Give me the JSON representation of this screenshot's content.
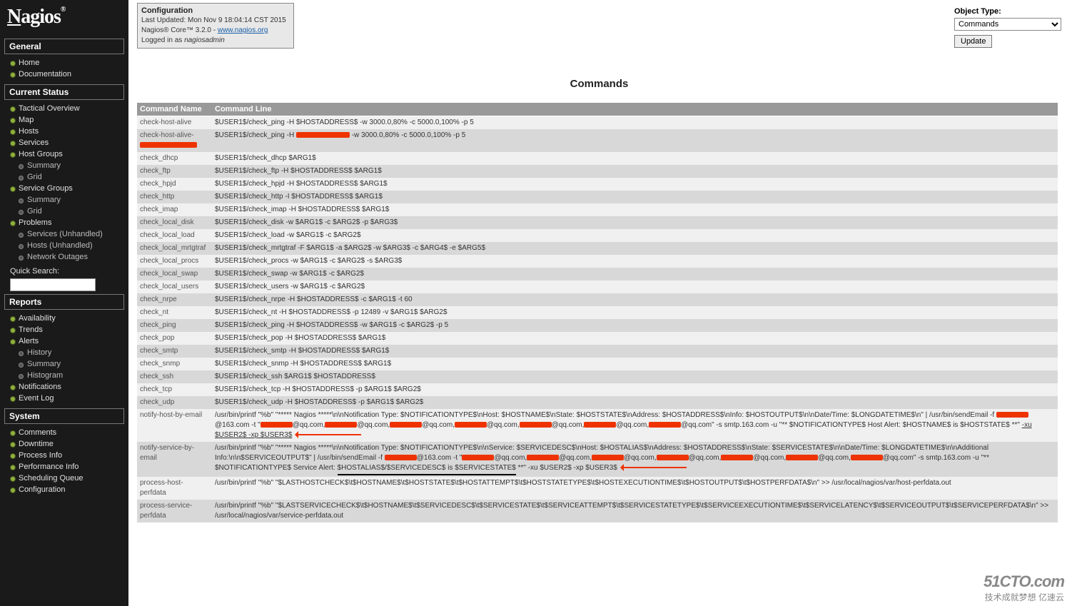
{
  "logo": "Nagios",
  "info_box": {
    "title": "Configuration",
    "last_updated": "Last Updated: Mon Nov 9 18:04:14 CST 2015",
    "version": "Nagios® Core™ 3.2.0 - ",
    "version_link": "www.nagios.org",
    "logged_in": "Logged in as ",
    "user": "nagiosadmin"
  },
  "top_right": {
    "label": "Object Type:",
    "selected": "Commands",
    "button": "Update"
  },
  "page_title": "Commands",
  "sidebar": {
    "general": {
      "header": "General",
      "items": [
        "Home",
        "Documentation"
      ]
    },
    "current_status": {
      "header": "Current Status",
      "items": [
        {
          "label": "Tactical Overview"
        },
        {
          "label": "Map"
        },
        {
          "label": "Hosts"
        },
        {
          "label": "Services"
        },
        {
          "label": "Host Groups",
          "subs": [
            "Summary",
            "Grid"
          ]
        },
        {
          "label": "Service Groups",
          "subs": [
            "Summary",
            "Grid"
          ]
        },
        {
          "label": "Problems",
          "subs": [
            "Services (Unhandled)",
            "Hosts (Unhandled)",
            "Network Outages"
          ]
        }
      ],
      "quick_search": "Quick Search:"
    },
    "reports": {
      "header": "Reports",
      "items": [
        {
          "label": "Availability"
        },
        {
          "label": "Trends"
        },
        {
          "label": "Alerts",
          "subs": [
            "History",
            "Summary",
            "Histogram"
          ]
        },
        {
          "label": "Notifications"
        },
        {
          "label": "Event Log"
        }
      ]
    },
    "system": {
      "header": "System",
      "items": [
        "Comments",
        "Downtime",
        "Process Info",
        "Performance Info",
        "Scheduling Queue",
        "Configuration"
      ]
    }
  },
  "table": {
    "headers": [
      "Command Name",
      "Command Line"
    ],
    "rows": [
      {
        "name": "check-host-alive",
        "line": "$USER1$/check_ping -H $HOSTADDRESS$ -w 3000.0,80% -c 5000.0,100% -p 5"
      },
      {
        "name": "check-host-alive-",
        "redact_name": true,
        "line_prefix": "$USER1$/check_ping -H ",
        "line_suffix": " -w 3000.0,80% -c 5000.0,100% -p 5",
        "redact_mid": true
      },
      {
        "name": "check_dhcp",
        "line": "$USER1$/check_dhcp $ARG1$"
      },
      {
        "name": "check_ftp",
        "line": "$USER1$/check_ftp -H $HOSTADDRESS$ $ARG1$"
      },
      {
        "name": "check_hpjd",
        "line": "$USER1$/check_hpjd -H $HOSTADDRESS$ $ARG1$"
      },
      {
        "name": "check_http",
        "line": "$USER1$/check_http -I $HOSTADDRESS$ $ARG1$"
      },
      {
        "name": "check_imap",
        "line": "$USER1$/check_imap -H $HOSTADDRESS$ $ARG1$"
      },
      {
        "name": "check_local_disk",
        "line": "$USER1$/check_disk -w $ARG1$ -c $ARG2$ -p $ARG3$"
      },
      {
        "name": "check_local_load",
        "line": "$USER1$/check_load -w $ARG1$ -c $ARG2$"
      },
      {
        "name": "check_local_mrtgtraf",
        "line": "$USER1$/check_mrtgtraf -F $ARG1$ -a $ARG2$ -w $ARG3$ -c $ARG4$ -e $ARG5$"
      },
      {
        "name": "check_local_procs",
        "line": "$USER1$/check_procs -w $ARG1$ -c $ARG2$ -s $ARG3$"
      },
      {
        "name": "check_local_swap",
        "line": "$USER1$/check_swap -w $ARG1$ -c $ARG2$"
      },
      {
        "name": "check_local_users",
        "line": "$USER1$/check_users -w $ARG1$ -c $ARG2$"
      },
      {
        "name": "check_nrpe",
        "line": "$USER1$/check_nrpe -H $HOSTADDRESS$ -c $ARG1$ -t 60"
      },
      {
        "name": "check_nt",
        "line": "$USER1$/check_nt -H $HOSTADDRESS$ -p 12489 -v $ARG1$ $ARG2$"
      },
      {
        "name": "check_ping",
        "line": "$USER1$/check_ping -H $HOSTADDRESS$ -w $ARG1$ -c $ARG2$ -p 5"
      },
      {
        "name": "check_pop",
        "line": "$USER1$/check_pop -H $HOSTADDRESS$ $ARG1$"
      },
      {
        "name": "check_smtp",
        "line": "$USER1$/check_smtp -H $HOSTADDRESS$ $ARG1$"
      },
      {
        "name": "check_snmp",
        "line": "$USER1$/check_snmp -H $HOSTADDRESS$ $ARG1$"
      },
      {
        "name": "check_ssh",
        "line": "$USER1$/check_ssh $ARG1$ $HOSTADDRESS$"
      },
      {
        "name": "check_tcp",
        "line": "$USER1$/check_tcp -H $HOSTADDRESS$ -p $ARG1$ $ARG2$"
      },
      {
        "name": "check_udp",
        "line": "$USER1$/check_udp -H $HOSTADDRESS$ -p $ARG1$ $ARG2$"
      },
      {
        "name": "notify-host-by-email",
        "line": "/usr/bin/printf \"%b\" \"***** Nagios *****\\n\\nNotification Type: $NOTIFICATIONTYPE$\\nHost: $HOSTNAME$\\nState: $HOSTSTATE$\\nAddress: $HOSTADDRESS$\\nInfo: $HOSTOUTPUT$\\n\\nDate/Time: $LONGDATETIME$\\n\" | /usr/bin/sendEmail -f ████@163.com -t \"████@qq.com,████@qq.com,████@qq.com,████@qq.com,████@qq.com,████@qq.com,████@qq.com\" -s smtp.163.com -u \"** $NOTIFICATIONTYPE$ Host Alert: $HOSTNAME$ is $HOSTSTATE$ **\" -xu $USER2$ -xp $USER3$",
        "special": "notify-host"
      },
      {
        "name": "notify-service-by-email",
        "line": "/usr/bin/printf \"%b\" \"***** Nagios *****\\n\\nNotification Type: $NOTIFICATIONTYPE$\\n\\nService: $SERVICEDESC$\\nHost: $HOSTALIAS$\\nAddress: $HOSTADDRESS$\\nState: $SERVICESTATE$\\n\\nDate/Time: $LONGDATETIME$\\n\\nAdditional Info:\\n\\n$SERVICEOUTPUT$\" | /usr/bin/sendEmail -f ████@163.com -t \"████@qq.com,████@qq.com,████@qq.com,████@qq.com,████@qq.com,████@qq.com,████@qq.com\" -s smtp.163.com -u \"** $NOTIFICATIONTYPE$ Service Alert: $HOSTALIAS$/$SERVICEDESC$ is $SERVICESTATE$ **\" -xu $USER2$ -xp $USER3$",
        "special": "notify-service"
      },
      {
        "name": "process-host-perfdata",
        "line": "/usr/bin/printf \"%b\" \"$LASTHOSTCHECK$\\t$HOSTNAME$\\t$HOSTSTATE$\\t$HOSTATTEMPT$\\t$HOSTSTATETYPE$\\t$HOSTEXECUTIONTIME$\\t$HOSTOUTPUT$\\t$HOSTPERFDATA$\\n\" >> /usr/local/nagios/var/host-perfdata.out"
      },
      {
        "name": "process-service-perfdata",
        "line": "/usr/bin/printf \"%b\" \"$LASTSERVICECHECK$\\t$HOSTNAME$\\t$SERVICEDESC$\\t$SERVICESTATE$\\t$SERVICEATTEMPT$\\t$SERVICESTATETYPE$\\t$SERVICEEXECUTIONTIME$\\t$SERVICELATENCY$\\t$SERVICEOUTPUT$\\t$SERVICEPERFDATA$\\n\" >> /usr/local/nagios/var/service-perfdata.out"
      }
    ]
  },
  "watermark": {
    "big": "51CTO.com",
    "small": "技术成就梦想   亿速云"
  }
}
